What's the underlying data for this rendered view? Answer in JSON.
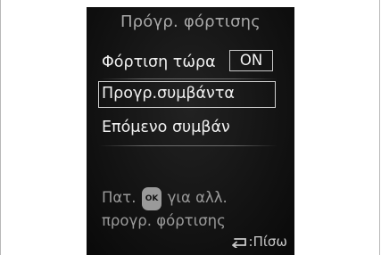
{
  "screen": {
    "title": "Πρόγρ. φόρτισης",
    "charge_now": {
      "label": "Φόρτιση τώρα",
      "value": "ON"
    },
    "menu_items": [
      {
        "label": "Προγρ.συμβάντα",
        "selected": true
      },
      {
        "label": "Επόμενο συμβάν",
        "selected": false
      }
    ],
    "hint": {
      "prefix": "Πατ.",
      "button": "OK",
      "suffix": "για αλλ.",
      "line2": "προγρ. φόρτισης"
    },
    "back": {
      "icon": "back-arrow-icon",
      "label": ":Πίσω"
    }
  },
  "colors": {
    "screen_bg": "#141414",
    "text": "#f0f0f0",
    "dim_text": "#9a9a9a"
  }
}
